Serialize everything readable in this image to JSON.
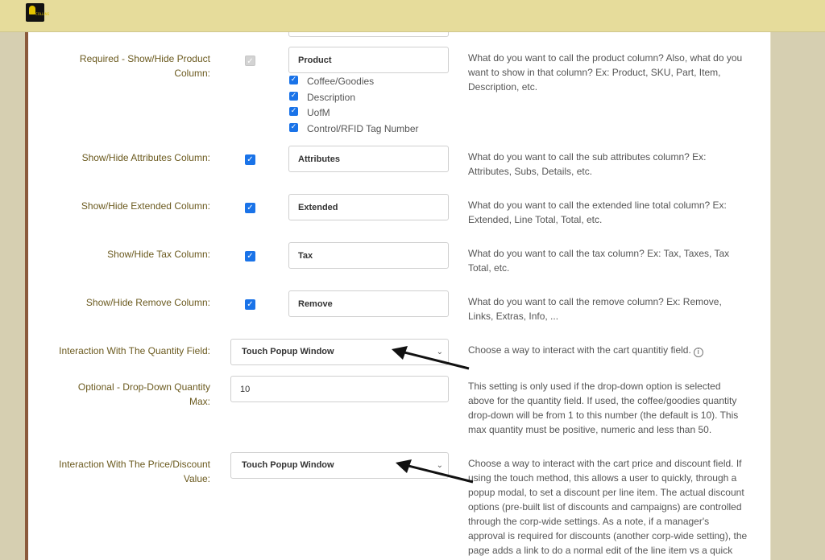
{
  "header": {
    "logo_alt": "Oakland Coffee logo",
    "logo_small_text": "COLLINS"
  },
  "product_column": {
    "label": "Required - Show/Hide Product Column:",
    "value": "Product",
    "desc": "What do you want to call the product column? Also, what do you want to show in that column? Ex: Product, SKU, Part, Item, Description, etc.",
    "options": [
      "Coffee/Goodies",
      "Description",
      "UofM",
      "Control/RFID Tag Number"
    ]
  },
  "attributes_column": {
    "label": "Show/Hide Attributes Column:",
    "value": "Attributes",
    "desc": "What do you want to call the sub attributes column? Ex: Attributes, Subs, Details, etc."
  },
  "extended_column": {
    "label": "Show/Hide Extended Column:",
    "value": "Extended",
    "desc": "What do you want to call the extended line total column? Ex: Extended, Line Total, Total, etc."
  },
  "tax_column": {
    "label": "Show/Hide Tax Column:",
    "value": "Tax",
    "desc": "What do you want to call the tax column? Ex: Tax, Taxes, Tax Total, etc."
  },
  "remove_column": {
    "label": "Show/Hide Remove Column:",
    "value": "Remove",
    "desc": "What do you want to call the remove column? Ex: Remove, Links, Extras, Info, ..."
  },
  "quantity_interaction": {
    "label": "Interaction With The Quantity Field:",
    "selected": "Touch Popup Window",
    "desc": "Choose a way to interact with the cart quantitiy field."
  },
  "quantity_max": {
    "label": "Optional - Drop-Down Quantity Max:",
    "value": "10",
    "desc": "This setting is only used if the drop-down option is selected above for the quantity field. If used, the coffee/goodies quantity drop-down will be from 1 to this number (the default is 10). This max quantity must be positive, numeric and less than 50."
  },
  "price_interaction": {
    "label": "Interaction With The Price/Discount Value:",
    "selected": "Touch Popup Window",
    "desc": "Choose a way to interact with the cart price and discount field. If using the touch method, this allows a user to quickly, through a popup modal, to set a discount per line item. The actual discount options (pre-built list of discounts and campaigns) are controlled through the corp-wide settings. As a note, if a manager's approval is required for discounts (another corp-wide setting), the page adds a link to do a normal edit of the line item vs a quick popup."
  },
  "colors": {
    "accent": "#1a73e8",
    "label": "#6b5a1f",
    "topbar": "#e6dc9b",
    "background": "#d6cfb1"
  }
}
